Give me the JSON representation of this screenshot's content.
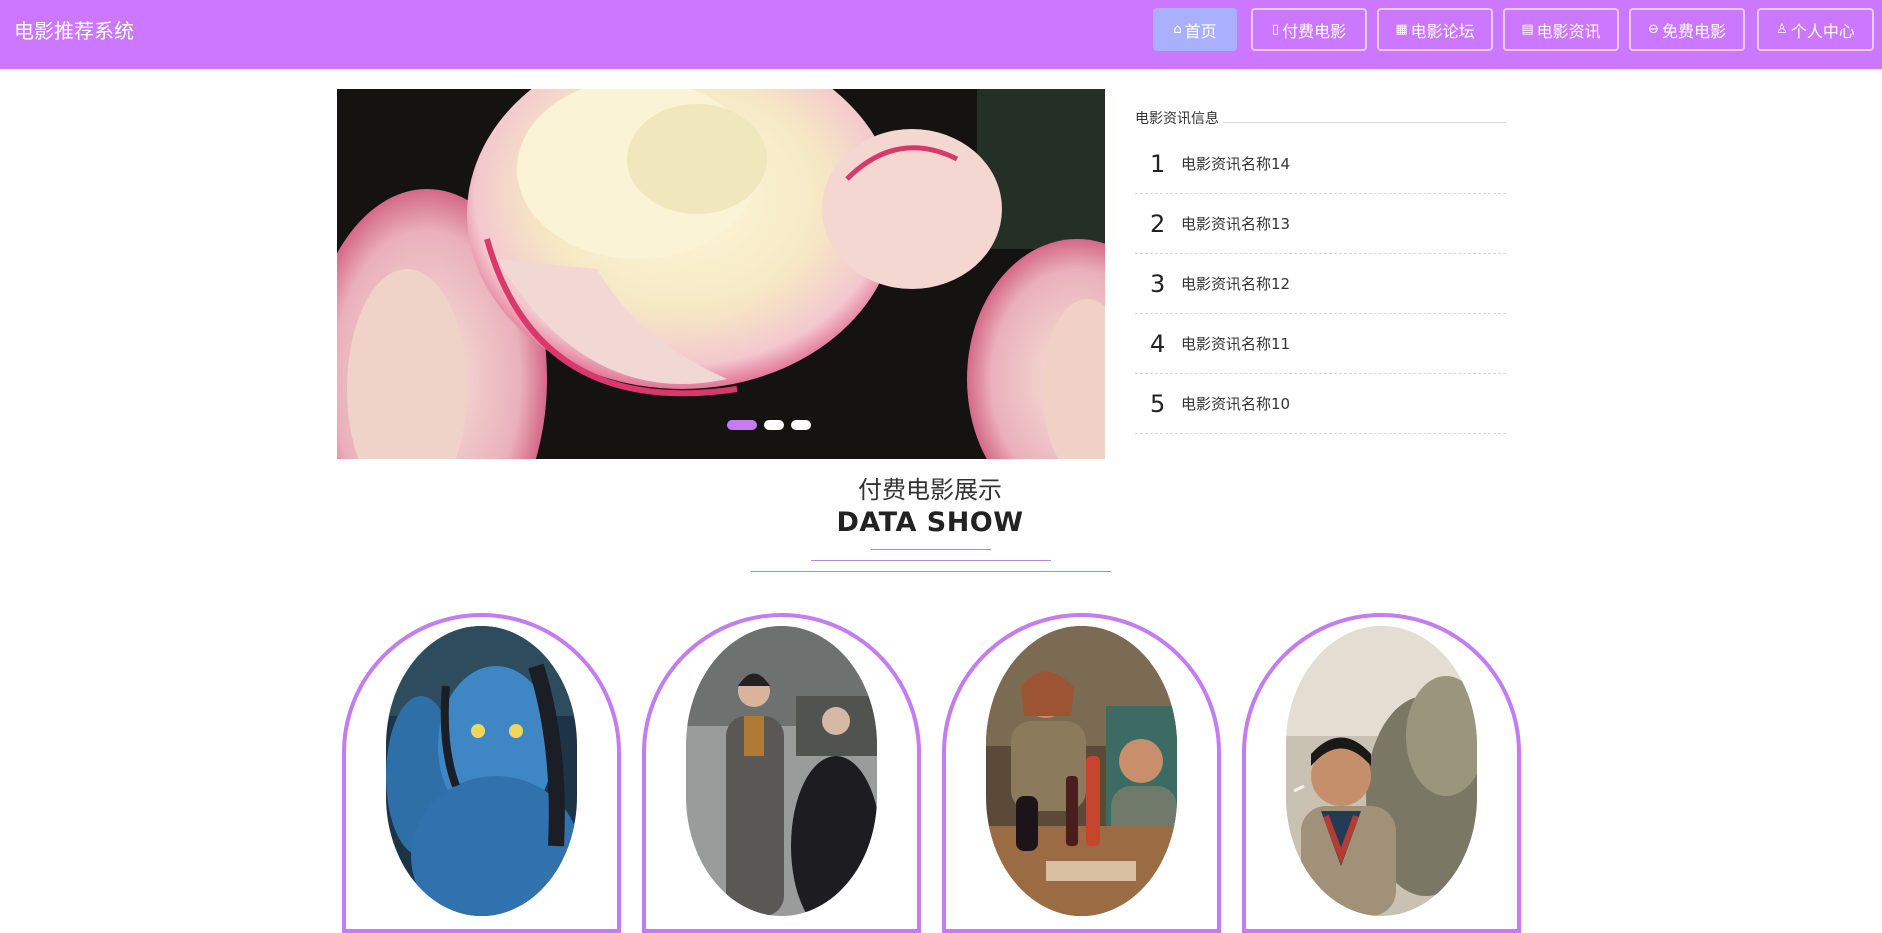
{
  "header": {
    "brand": "电影推荐系统",
    "nav": [
      {
        "icon": "home-icon",
        "glyph": "⌂",
        "label": "首页",
        "active": true
      },
      {
        "icon": "film-icon",
        "glyph": "▯",
        "label": "付费电影"
      },
      {
        "icon": "grid-icon",
        "glyph": "▦",
        "label": "电影论坛"
      },
      {
        "icon": "news-icon",
        "glyph": "▤",
        "label": "电影资讯"
      },
      {
        "icon": "ticket-icon",
        "glyph": "⊖",
        "label": "免费电影"
      },
      {
        "icon": "user-icon",
        "glyph": "♙",
        "label": "个人中心"
      }
    ]
  },
  "carousel": {
    "slide_count": 3,
    "active_index": 0,
    "image": "rose-flowers-photo"
  },
  "news": {
    "heading": "电影资讯信息",
    "items": [
      {
        "num": "1",
        "title": "电影资讯名称14"
      },
      {
        "num": "2",
        "title": "电影资讯名称13"
      },
      {
        "num": "3",
        "title": "电影资讯名称12"
      },
      {
        "num": "4",
        "title": "电影资讯名称11"
      },
      {
        "num": "5",
        "title": "电影资讯名称10"
      }
    ]
  },
  "showcase": {
    "title": "付费电影展示",
    "subtitle": "DATA SHOW",
    "movies": [
      {
        "image": "blue-alien-character-poster"
      },
      {
        "image": "woman-in-grey-coat-poster"
      },
      {
        "image": "dinner-table-scene-poster"
      },
      {
        "image": "man-with-cigarette-poster"
      }
    ]
  },
  "colors": {
    "header_bg": "#cc77ff",
    "accent": "#c37cf2",
    "active_nav": "#aab0ff"
  }
}
